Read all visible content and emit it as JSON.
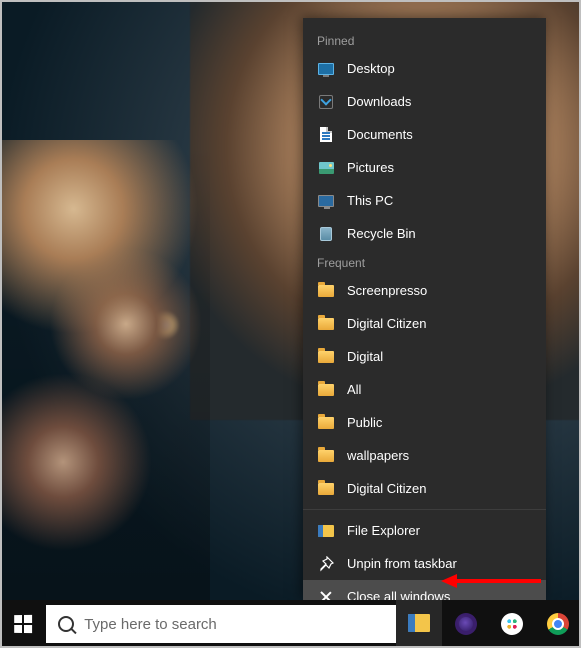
{
  "jumplist": {
    "sections": {
      "pinned": {
        "title": "Pinned"
      },
      "frequent": {
        "title": "Frequent"
      }
    },
    "pinned_items": [
      {
        "label": "Desktop",
        "icon": "desktop-icon"
      },
      {
        "label": "Downloads",
        "icon": "downloads-icon"
      },
      {
        "label": "Documents",
        "icon": "documents-icon"
      },
      {
        "label": "Pictures",
        "icon": "pictures-icon"
      },
      {
        "label": "This PC",
        "icon": "this-pc-icon"
      },
      {
        "label": "Recycle Bin",
        "icon": "recycle-bin-icon"
      }
    ],
    "frequent_items": [
      {
        "label": "Screenpresso",
        "icon": "folder-icon"
      },
      {
        "label": "Digital Citizen",
        "icon": "folder-icon"
      },
      {
        "label": "Digital",
        "icon": "folder-icon"
      },
      {
        "label": "All",
        "icon": "folder-icon"
      },
      {
        "label": "Public",
        "icon": "folder-icon"
      },
      {
        "label": "wallpapers",
        "icon": "folder-icon"
      },
      {
        "label": "Digital Citizen",
        "icon": "folder-icon"
      }
    ],
    "actions": [
      {
        "label": "File Explorer",
        "icon": "file-explorer-icon"
      },
      {
        "label": "Unpin from taskbar",
        "icon": "unpin-icon"
      },
      {
        "label": "Close all windows",
        "icon": "close-icon",
        "hover": true
      }
    ]
  },
  "taskbar": {
    "search_placeholder": "Type here to search",
    "buttons": [
      {
        "name": "file-explorer",
        "active": true
      },
      {
        "name": "firefox"
      },
      {
        "name": "slack"
      },
      {
        "name": "chrome"
      }
    ]
  },
  "annotation": {
    "arrow_color": "#ff0000"
  }
}
